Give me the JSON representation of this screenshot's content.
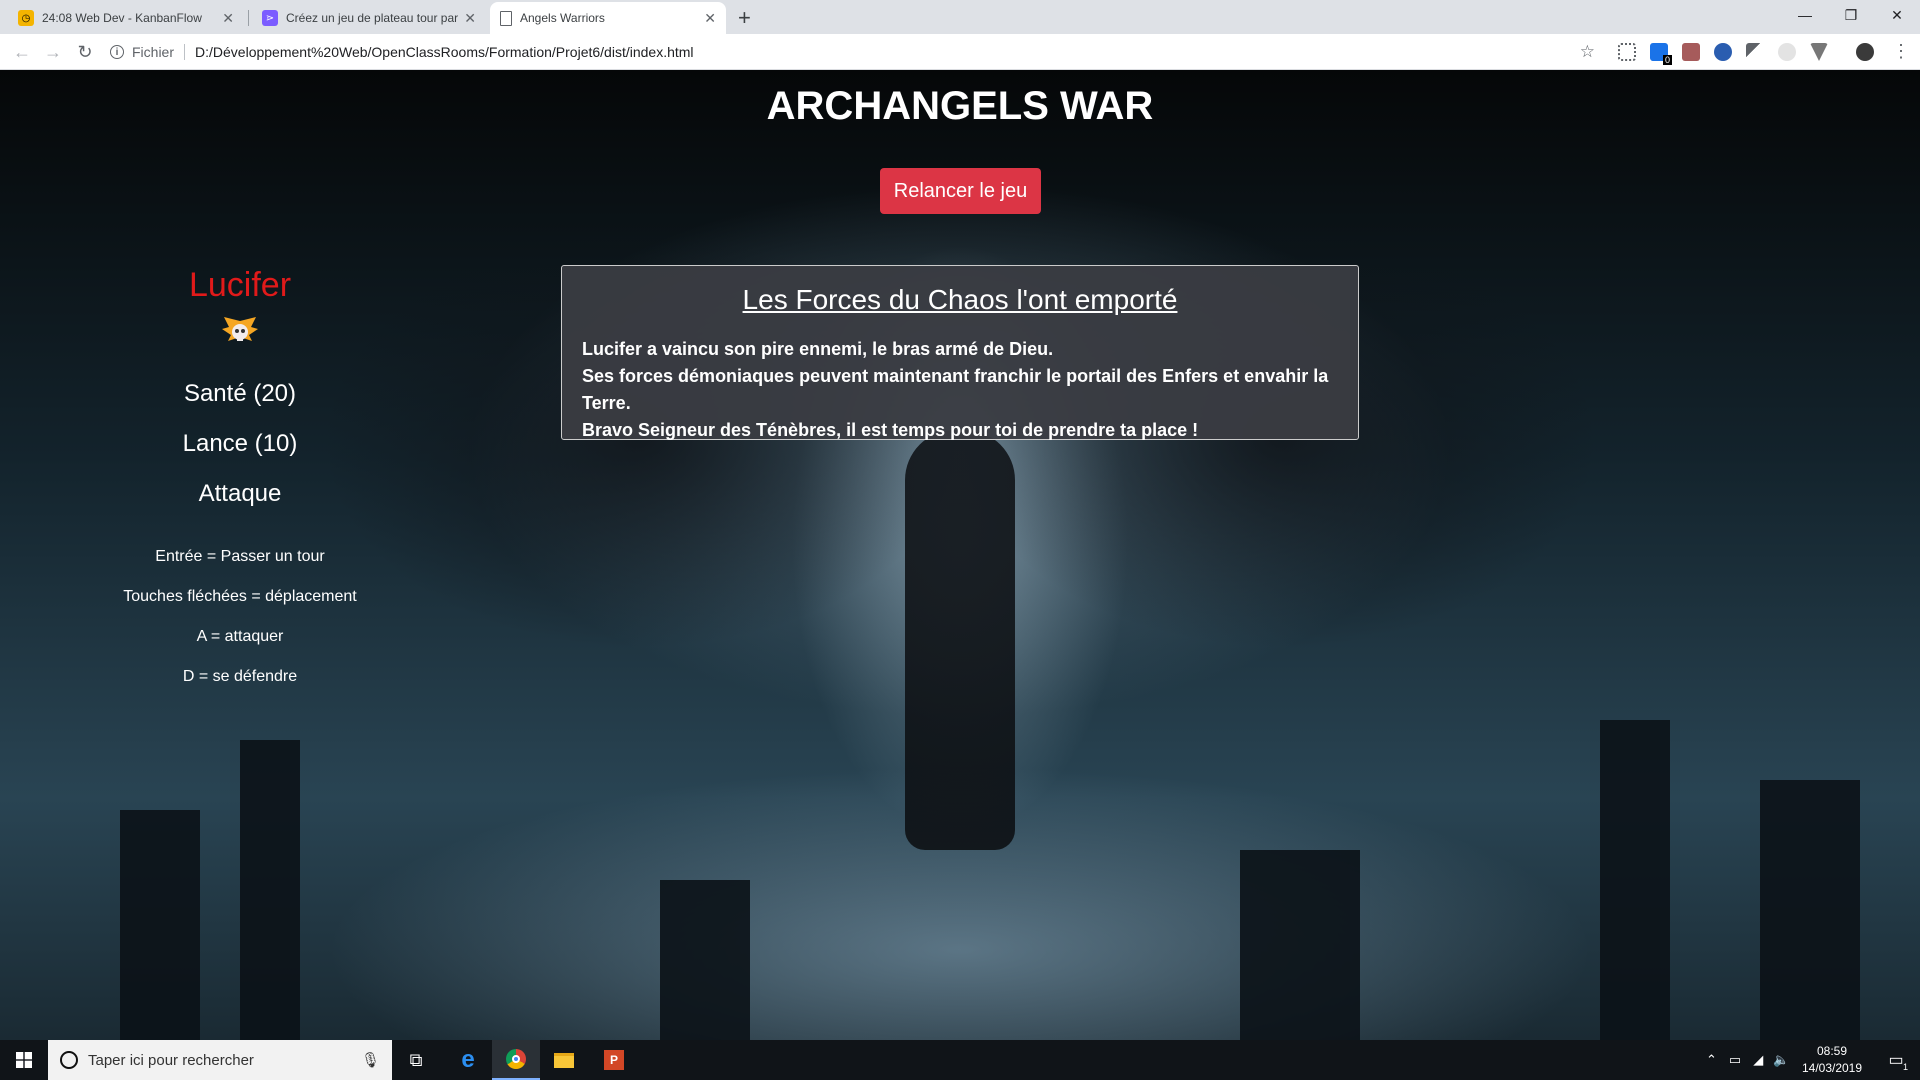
{
  "browser": {
    "tabs": [
      {
        "title": "24:08 Web Dev - KanbanFlow",
        "favicon_color": "#f4b400"
      },
      {
        "title": "Créez un jeu de plateau tour par",
        "favicon_color": "#7b5cff"
      },
      {
        "title": "Angels Warriors",
        "favicon_color": "#ffffff"
      }
    ],
    "address": {
      "scheme": "Fichier",
      "url": "D:/Développement%20Web/OpenClassRooms/Formation/Projet6/dist/index.html"
    },
    "extension_badge": "0"
  },
  "game": {
    "title": "ARCHANGELS WAR",
    "restart_label": "Relancer le jeu",
    "player": {
      "name": "Lucifer",
      "name_color": "#e01a1a",
      "health_label": "Santé (20)",
      "weapon_label": "Lance (10)",
      "state_label": "Attaque"
    },
    "controls": [
      "Entrée = Passer un tour",
      "Touches fléchées = déplacement",
      "A = attaquer",
      "D = se défendre"
    ],
    "message": {
      "title": "Les Forces du Chaos l'ont emporté",
      "lines": [
        "Lucifer a vaincu son pire ennemi, le bras armé de Dieu.",
        "Ses forces démoniaques peuvent maintenant franchir le portail des Enfers et envahir la Terre.",
        "Bravo Seigneur des Ténèbres, il est temps pour toi de prendre ta place !"
      ]
    }
  },
  "taskbar": {
    "search_placeholder": "Taper ici pour rechercher",
    "time": "08:59",
    "date": "14/03/2019",
    "notification_count": "1"
  },
  "colors": {
    "restart_button": "#dc3545",
    "accent": "#e01a1a"
  }
}
